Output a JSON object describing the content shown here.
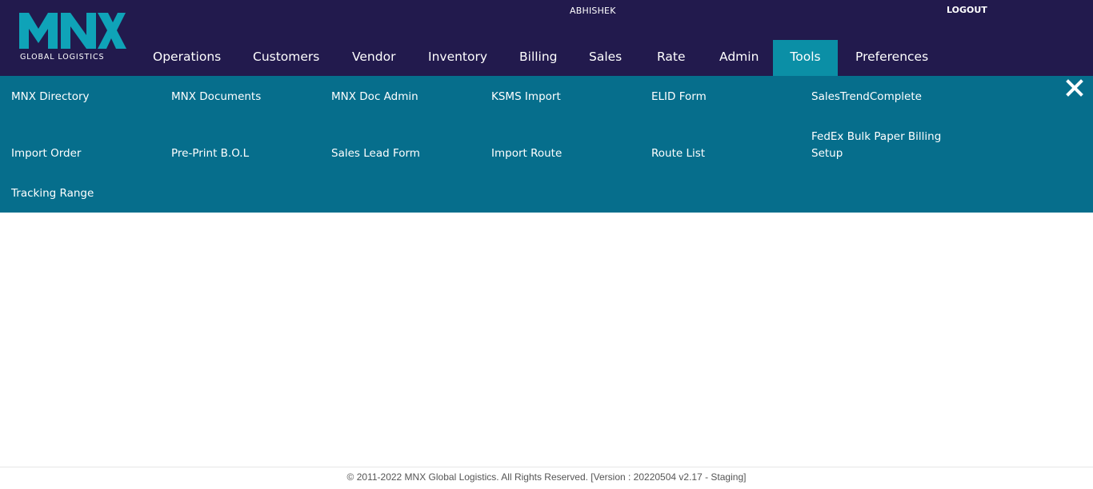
{
  "logo": {
    "mark": "MNX",
    "subtitle": "GLOBAL LOGISTICS"
  },
  "user": {
    "name": "ABHISHEK",
    "logout_label": "LOGOUT"
  },
  "nav": {
    "items": [
      "Operations",
      "Customers",
      "Vendor",
      "Inventory",
      "Billing",
      "Sales",
      "Rate",
      "Admin",
      "Tools",
      "Preferences"
    ],
    "active": "Tools"
  },
  "tools_menu": {
    "links": [
      "MNX Directory",
      "MNX Documents",
      "MNX Doc Admin",
      "KSMS Import",
      "ELID Form",
      "SalesTrendComplete",
      "Import Order",
      "Pre-Print B.O.L",
      "Sales Lead Form",
      "Import Route",
      "Route List",
      "FedEx Bulk Paper Billing Setup",
      "Tracking Range"
    ],
    "close_icon": "close-icon"
  },
  "footer": {
    "text": "© 2011-2022 MNX Global Logistics. All Rights Reserved. [Version : 20220504 v2.17 - Staging]"
  },
  "colors": {
    "header_bg": "#221a4d",
    "accent": "#0b8fa6",
    "submenu_bg": "#066e8c"
  }
}
